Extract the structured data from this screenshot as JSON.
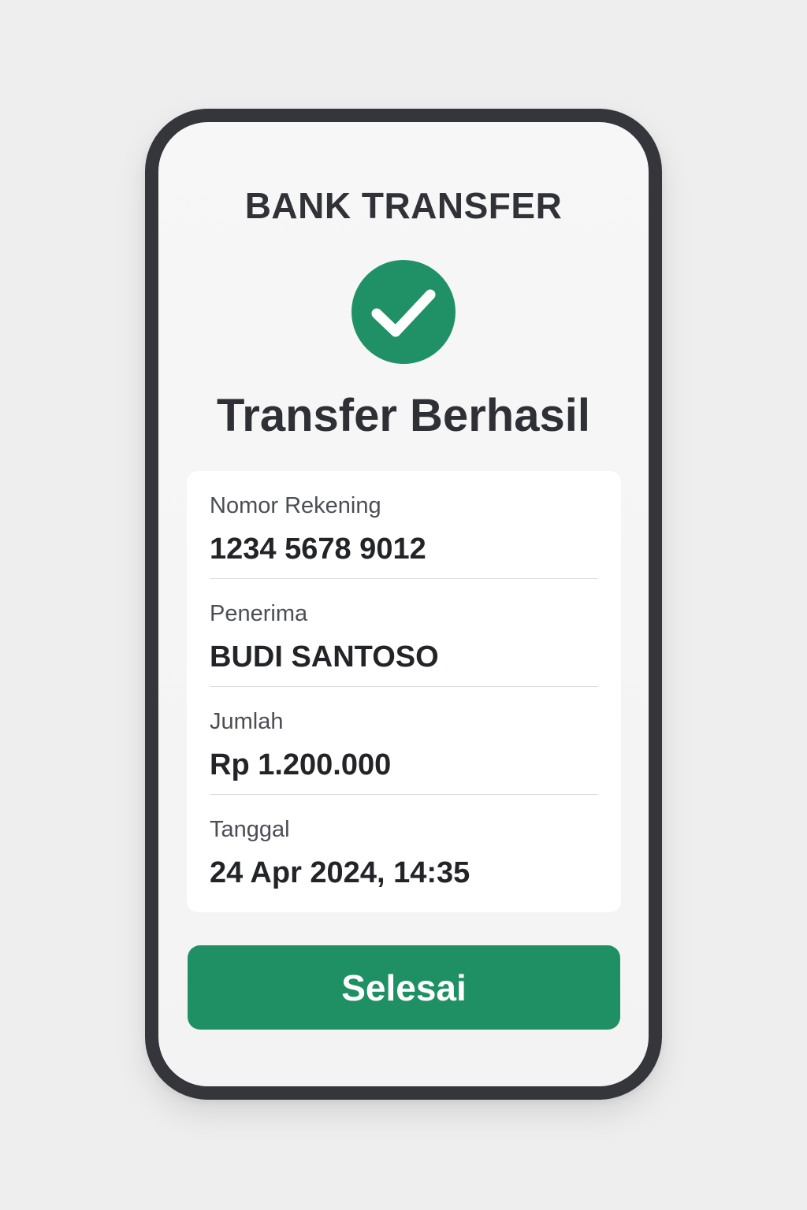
{
  "header": {
    "title": "BANK TRANSFER"
  },
  "status": {
    "icon": "check-circle-icon",
    "title": "Transfer Berhasil",
    "accent_color": "#209166"
  },
  "details": [
    {
      "label": "Nomor Rekening",
      "value": "1234 5678 9012"
    },
    {
      "label": "Penerima",
      "value": "BUDI SANTOSO"
    },
    {
      "label": "Jumlah",
      "value": "Rp 1.200.000"
    },
    {
      "label": "Tanggal",
      "value": "24 Apr 2024, 14:35"
    }
  ],
  "actions": {
    "done_label": "Selesai",
    "button_color": "#1f9063"
  }
}
